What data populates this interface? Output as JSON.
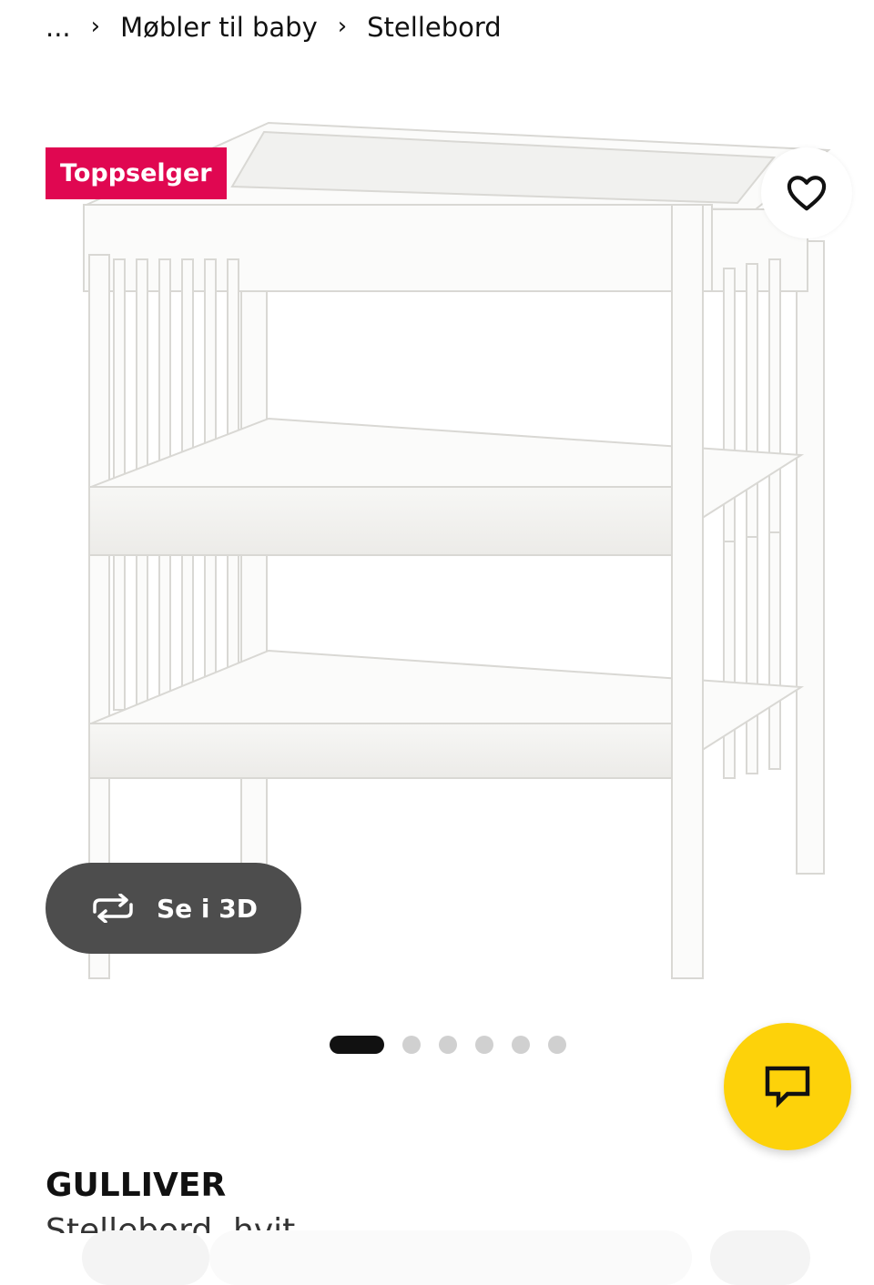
{
  "breadcrumb": {
    "ellipsis": "...",
    "separator": "›",
    "items": [
      "Møbler til baby",
      "Stellebord"
    ]
  },
  "badge": {
    "label": "Toppselger",
    "color": "#e00751"
  },
  "favorite": {
    "icon": "heart-icon"
  },
  "view3d": {
    "label": "Se i 3D",
    "icon": "rotate-icon"
  },
  "carousel": {
    "total": 6,
    "active_index": 0
  },
  "chat": {
    "icon": "chat-bubble-icon",
    "color": "#fdd20a"
  },
  "product": {
    "name": "GULLIVER",
    "description": "Stellebord, hvit"
  }
}
